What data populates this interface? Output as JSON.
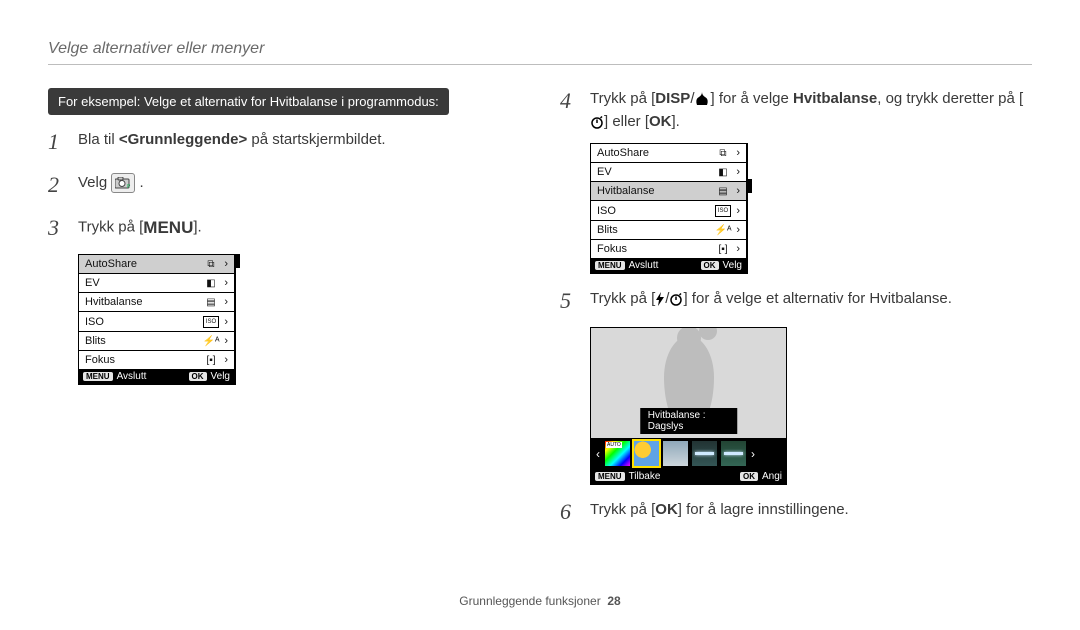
{
  "header": {
    "title": "Velge alternativer eller menyer"
  },
  "example_label": "For eksempel: Velge et alternativ for Hvitbalanse i programmodus:",
  "steps": {
    "s1": {
      "n": "1",
      "pre": "Bla til ",
      "bold": "<Grunnleggende>",
      "post": " på startskjermbildet."
    },
    "s2": {
      "n": "2",
      "pre": "Velg ",
      "post": "."
    },
    "s3": {
      "n": "3",
      "pre": "Trykk på [",
      "btn": "MENU",
      "post": "]."
    },
    "s4": {
      "n": "4",
      "pre": "Trykk på [",
      "b1": "DISP",
      "sep": "/",
      "macro": "❀",
      "mid": "] for å velge ",
      "bold": "Hvitbalanse",
      "mid2": ", og trykk deretter på [",
      "timer": "(⏲)",
      "or": "] eller [",
      "ok": "OK",
      "post": "]."
    },
    "s5": {
      "n": "5",
      "pre": "Trykk på [",
      "flash": "⚡",
      "sep": "/",
      "timer": "⏲",
      "post": "] for å velge et alternativ for Hvitbalanse."
    },
    "s6": {
      "n": "6",
      "pre": "Trykk på [",
      "ok": "OK",
      "post": "] for å lagre innstillingene."
    }
  },
  "menu": {
    "items": [
      {
        "label": "AutoShare",
        "icon": "⧉"
      },
      {
        "label": "EV",
        "icon": "◧"
      },
      {
        "label": "Hvitbalanse",
        "icon": "▤"
      },
      {
        "label": "ISO",
        "icon": "ISO"
      },
      {
        "label": "Blits",
        "icon": "⚡ᴬ"
      },
      {
        "label": "Fokus",
        "icon": "[▪]"
      }
    ],
    "footer": {
      "left_btn": "MENU",
      "left": "Avslutt",
      "right_btn": "OK",
      "right": "Velg"
    }
  },
  "opt": {
    "label": "Hvitbalanse : Dagslys",
    "footer": {
      "left_btn": "MENU",
      "left": "Tilbake",
      "right_btn": "OK",
      "right": "Angi"
    }
  },
  "footer": {
    "text": "Grunnleggende funksjoner",
    "page": "28"
  }
}
